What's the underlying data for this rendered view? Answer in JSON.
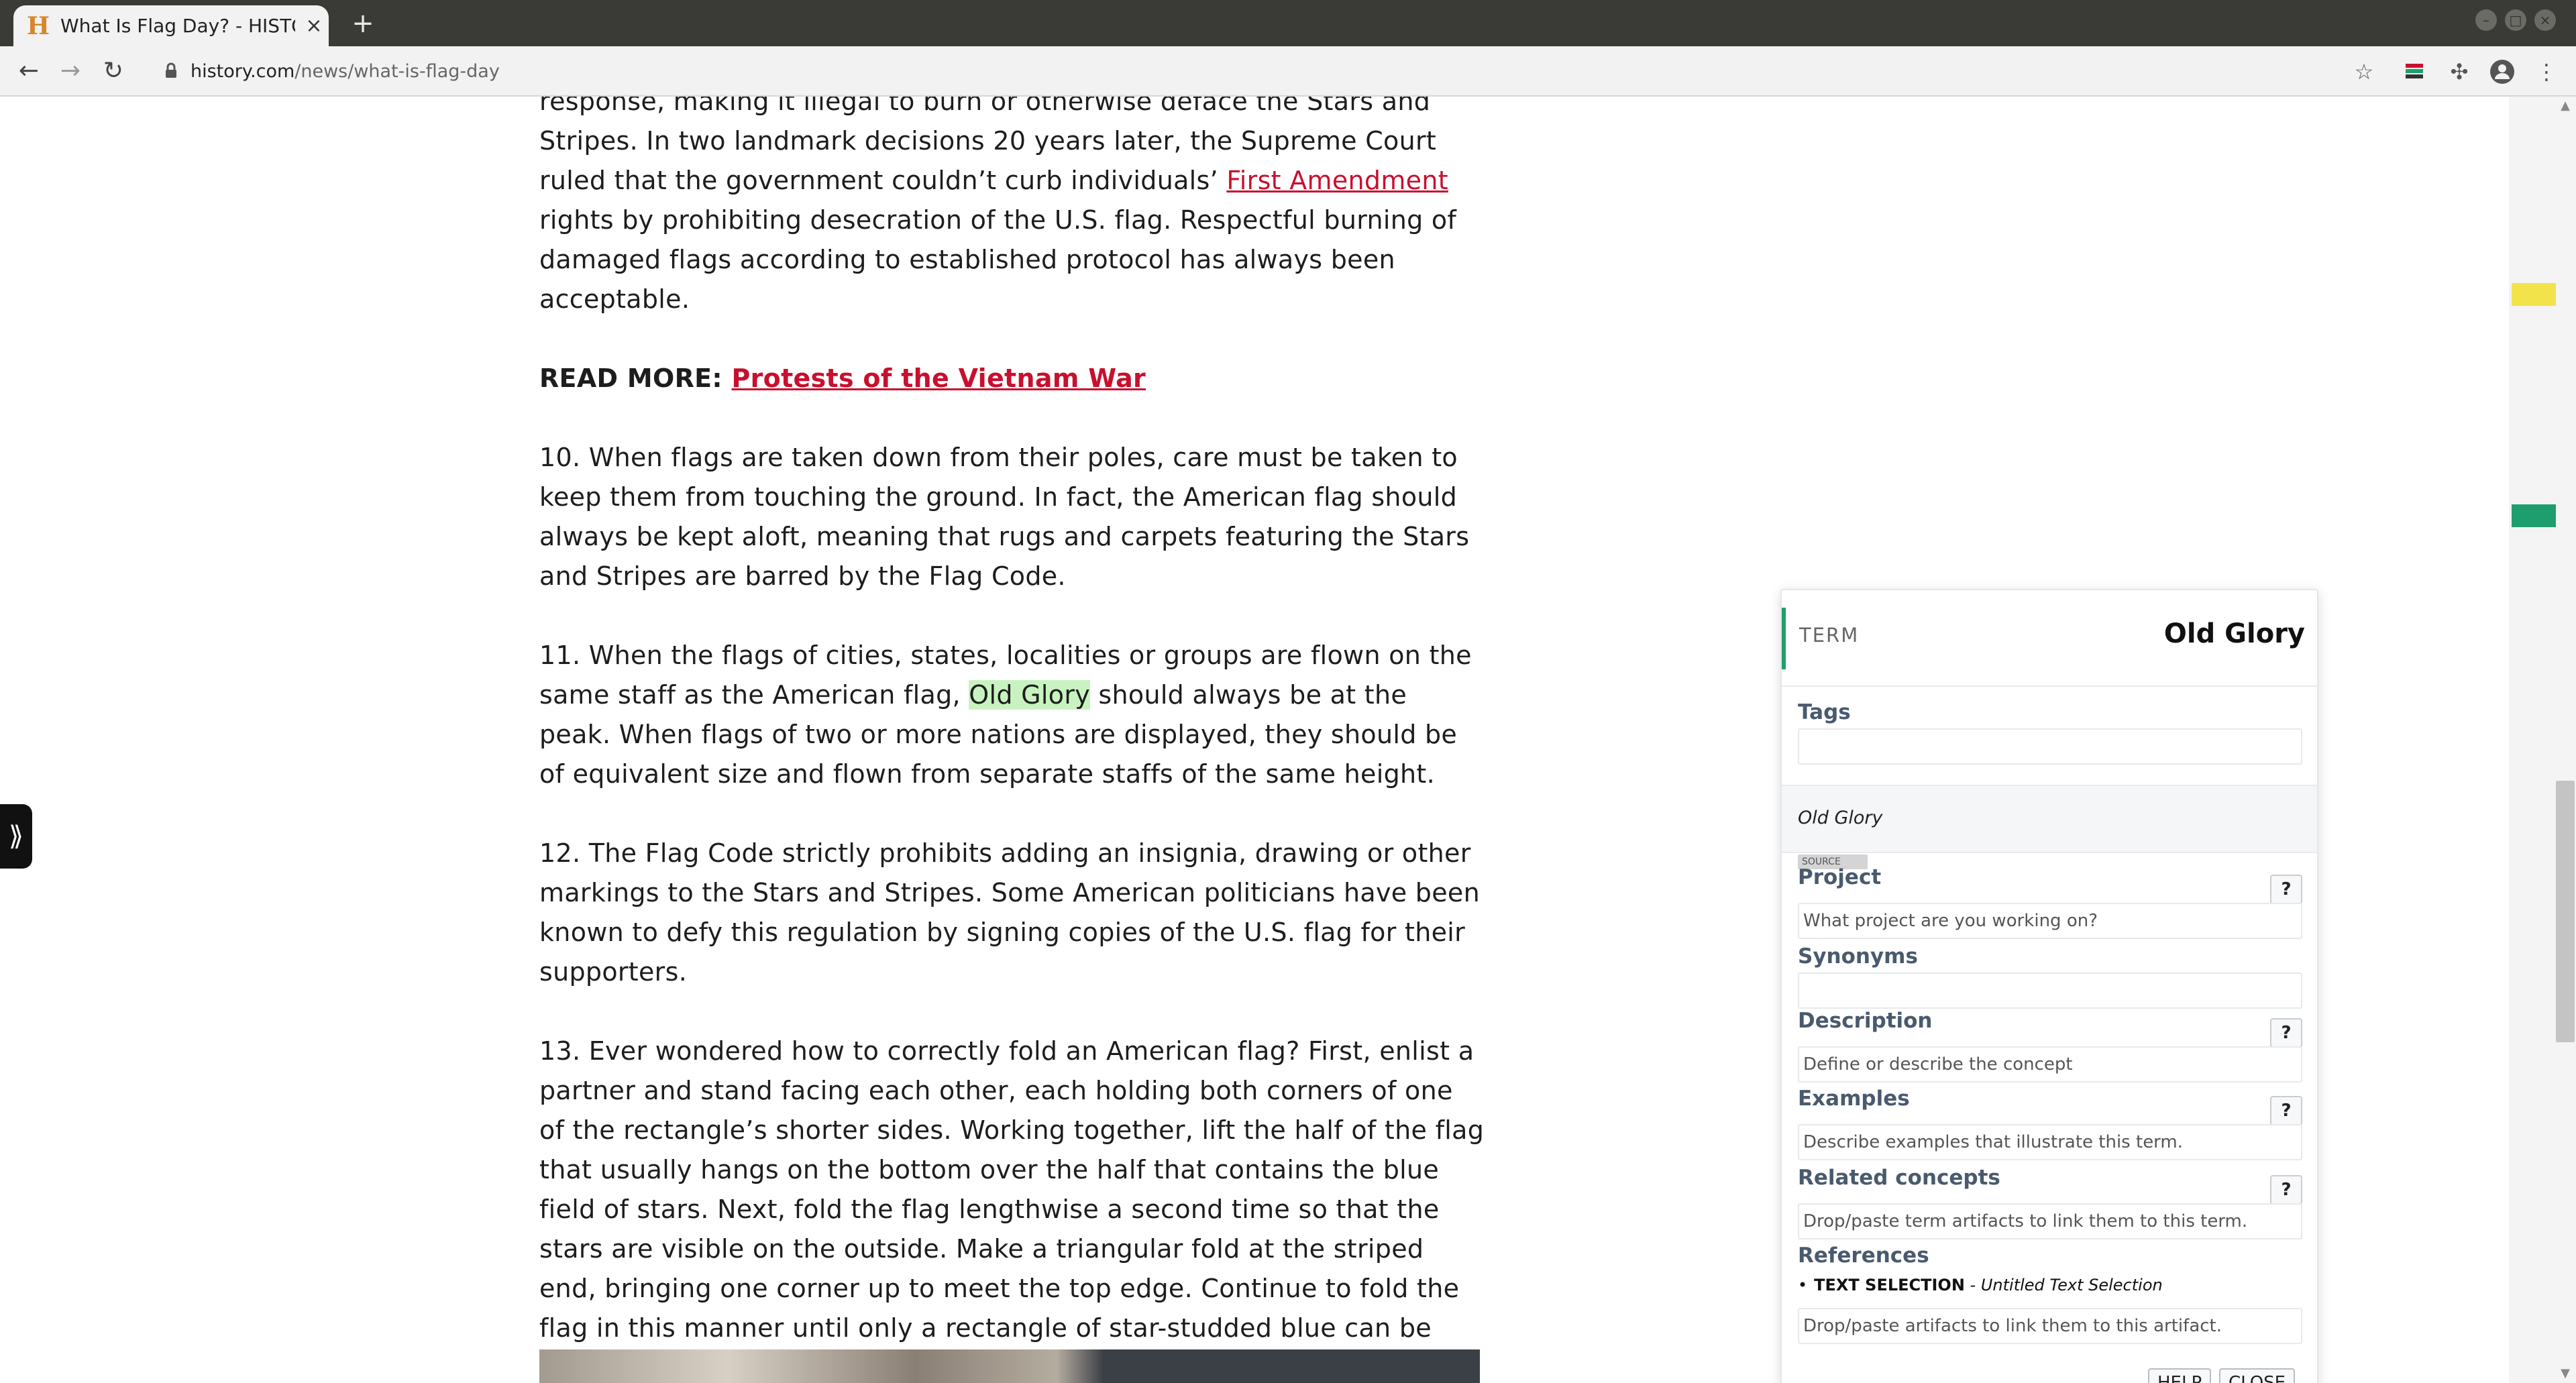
{
  "browser": {
    "tab_title": "What Is Flag Day? - HISTO",
    "tab_close": "×",
    "new_tab": "+",
    "url_host": "history.com",
    "url_path": "/news/what-is-flag-day"
  },
  "article": {
    "p0_before": "response, making it illegal to burn or otherwise deface the Stars and Stripes. In two landmark decisions 20 years later, the Supreme Court ruled that the government couldn’t curb individuals’ ",
    "p0_link": "First Amendment",
    "p0_after": " rights by prohibiting desecration of the U.S. flag. Respectful burning of damaged flags according to established protocol has always been acceptable.",
    "readmore_label": "READ MORE: ",
    "readmore_link": "Protests of the Vietnam War ",
    "p10": "10. When flags are taken down from their poles, care must be taken to keep them from touching the ground. In fact, the American flag should always be kept aloft, meaning that rugs and carpets featuring the Stars and Stripes are barred by the Flag Code.",
    "p11_before": "11. When the flags of cities, states, localities or groups are flown on the same staff as the American flag, ",
    "p11_highlight": "Old Glory",
    "p11_after": " should always be at the peak. When flags of two or more nations are displayed, they should be of equivalent size and flown from separate staffs of the same height.",
    "p12": "12. The Flag Code strictly prohibits adding an insignia, drawing or other markings to the Stars and Stripes. Some American politicians have been known to defy this regulation by signing copies of the U.S. flag for their supporters.",
    "p13": "13. Ever wondered how to correctly fold an American flag? First, enlist a partner and stand facing each other, each holding both corners of one of the rectangle’s shorter sides. Working together, lift the half of the flag that usually hangs on the bottom over the half that contains the blue field of stars. Next, fold the flag lengthwise a second time so that the stars are visible on the outside. Make a triangular fold at the striped end, bringing one corner up to meet the top edge. Continue to fold the flag in this manner until only a rectangle of star-studded blue can be seen."
  },
  "side_handle": "⟫",
  "panel": {
    "type_label": "TERM",
    "term_name": "Old Glory",
    "tags_label": "Tags",
    "alias": "Old Glory",
    "source_tag": "SOURCE",
    "project_label": "Project",
    "project_placeholder": "What project are you working on?",
    "synonyms_label": "Synonyms",
    "description_label": "Description",
    "description_placeholder": "Define or describe the concept",
    "examples_label": "Examples",
    "examples_placeholder": "Describe examples that illustrate this term.",
    "related_label": "Related concepts",
    "related_placeholder": "Drop/paste term artifacts to link them to this term.",
    "references_label": "References",
    "ref_bullet": "•",
    "ref_type": "TEXT SELECTION",
    "ref_title": " - Untitled Text Selection",
    "references_placeholder": "Drop/paste artifacts to link them to this artifact.",
    "help_q": "?",
    "help_button": "HELP",
    "close_button": "CLOSE"
  },
  "colors": {
    "link": "#c8102e",
    "highlight": "#c8f3c0",
    "accent": "#1e9e6e",
    "scroll_marker_yellow": "#f2e34a",
    "scroll_marker_green": "#1e9e6e"
  }
}
